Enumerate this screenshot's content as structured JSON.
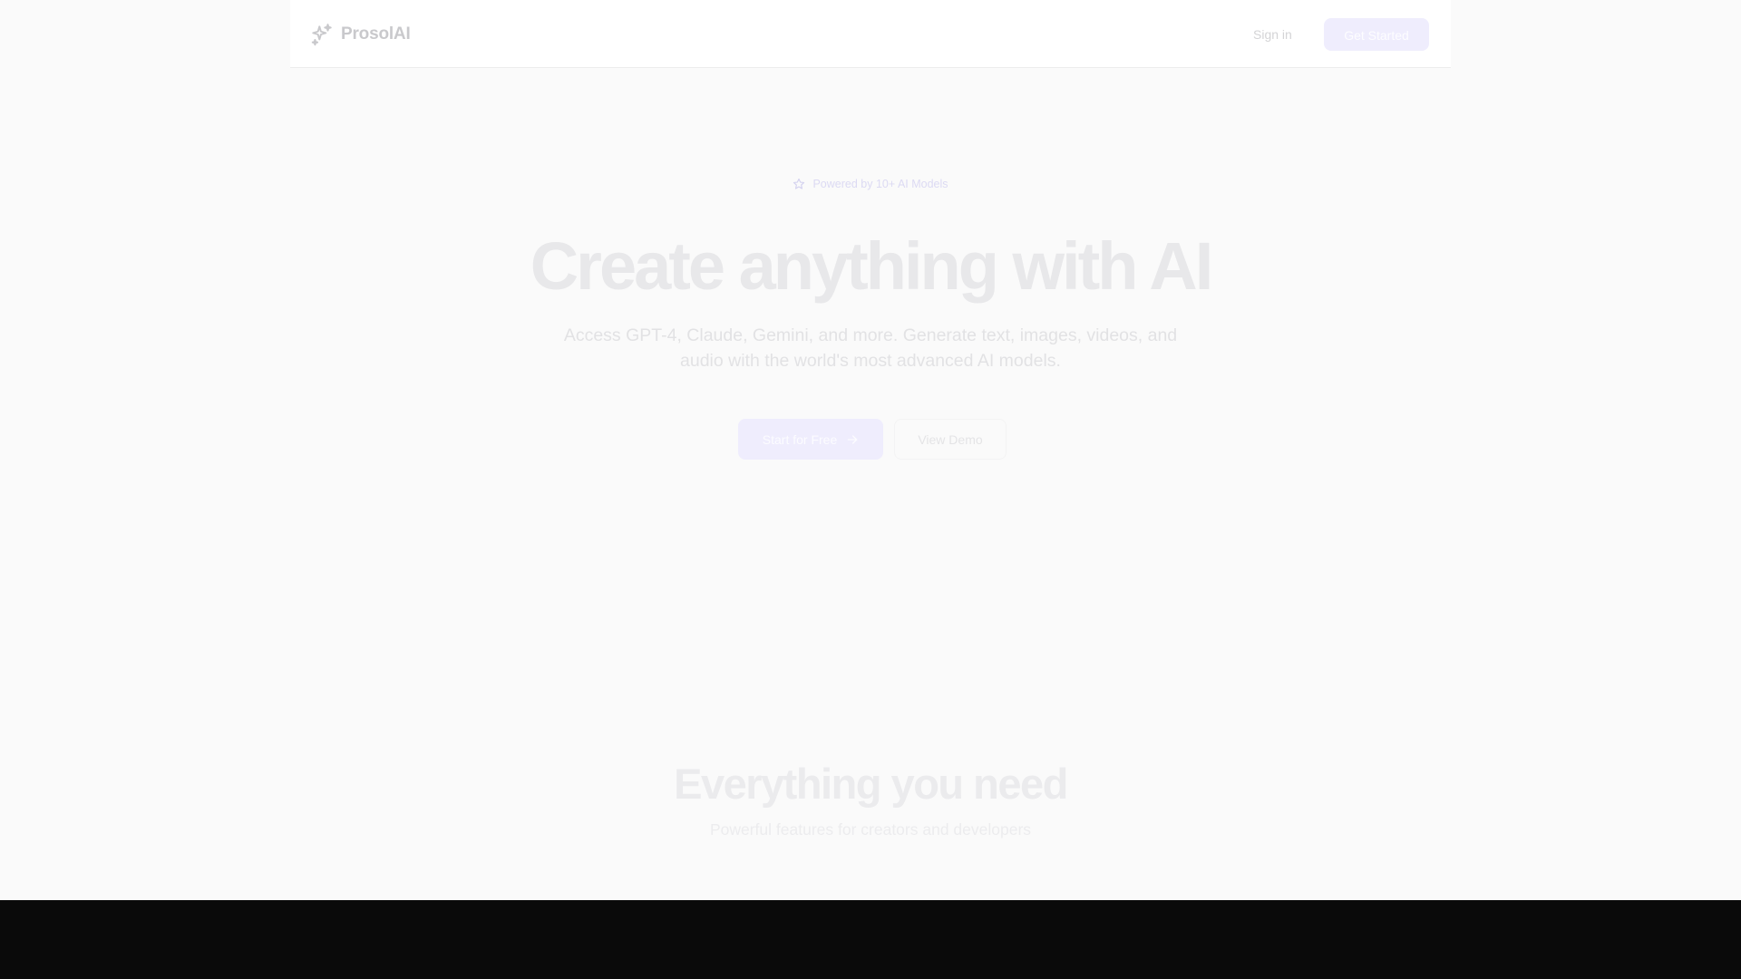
{
  "header": {
    "brand": "ProsolAI",
    "signin_label": "Sign in",
    "get_started_label": "Get Started"
  },
  "hero": {
    "badge_text": "Powered by 10+ AI Models",
    "title": "Create anything with AI",
    "subtitle": "Access GPT-4, Claude, Gemini, and more. Generate text, images, videos, and audio with the world's most advanced AI models.",
    "primary_cta": "Start for Free",
    "secondary_cta": "View Demo"
  },
  "features": {
    "title": "Everything you need",
    "subtitle": "Powerful features for creators and developers"
  },
  "colors": {
    "accent": "#efedfd",
    "dark_band": "#0a0a0a",
    "background": "#fafafa"
  },
  "icons": {
    "logo": "sparkles-icon",
    "badge": "star-icon",
    "cta_arrow": "arrow-right-icon"
  }
}
